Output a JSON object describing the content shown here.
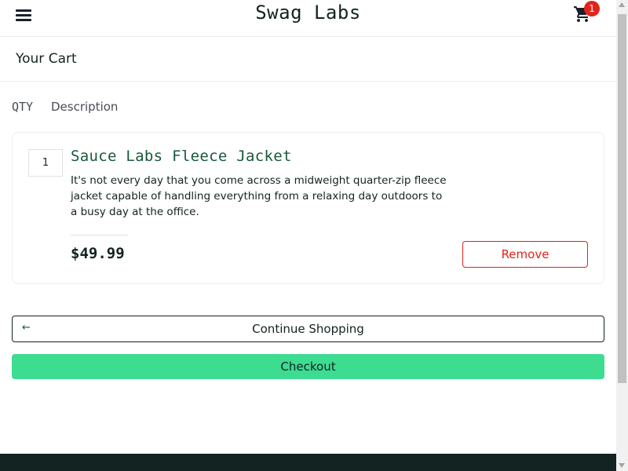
{
  "header": {
    "app_title": "Swag Labs",
    "cart_count": "1",
    "menu_icon": "hamburger-menu-icon",
    "cart_icon": "shopping-cart-icon"
  },
  "page": {
    "title": "Your Cart",
    "qty_label": "QTY",
    "description_label": "Description"
  },
  "cart_items": [
    {
      "quantity": "1",
      "name": "Sauce Labs Fleece Jacket",
      "description": "It's not every day that you come across a midweight quarter-zip fleece jacket capable of handling everything from a relaxing day outdoors to a busy day at the office.",
      "price": "$49.99",
      "remove_label": "Remove"
    }
  ],
  "actions": {
    "continue_label": "Continue Shopping",
    "continue_icon": "arrow-left-icon",
    "checkout_label": "Checkout"
  },
  "colors": {
    "accent_green": "#3ddc91",
    "title_green": "#18583a",
    "remove_red": "#e2231a",
    "footer_dark": "#132322"
  }
}
